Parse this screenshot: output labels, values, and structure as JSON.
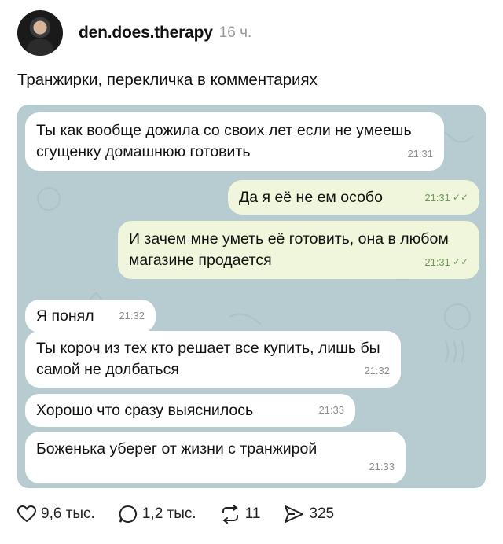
{
  "post": {
    "username": "den.does.therapy",
    "time": "16 ч.",
    "caption": "Транжирки, перекличка в комментариях"
  },
  "chat": {
    "messages": [
      {
        "side": "in",
        "text": "Ты как вообще дожила со своих лет если не умеешь сгущенку домашнюю готовить",
        "time": "21:31"
      },
      {
        "side": "out",
        "text": "Да я её не ем особо",
        "time": "21:31"
      },
      {
        "side": "out",
        "text": "И зачем мне уметь её готовить, она в любом магазине продается",
        "time": "21:31"
      },
      {
        "side": "in",
        "text": "Я понял",
        "time": "21:32"
      },
      {
        "side": "in",
        "text": "Ты короч из тех кто решает все купить, лишь бы самой не долбаться",
        "time": "21:32"
      },
      {
        "side": "in",
        "text": "Хорошо что сразу выяснилось",
        "time": "21:33"
      },
      {
        "side": "in",
        "text": "Боженька уберег от жизни с транжирой",
        "time": "21:33"
      }
    ],
    "read_mark": "✓✓"
  },
  "actions": {
    "likes": "9,6 тыс.",
    "comments": "1,2 тыс.",
    "reposts": "11",
    "shares": "325"
  },
  "icons": {
    "like": "heart-icon",
    "comment": "comment-icon",
    "repost": "repost-icon",
    "share": "send-icon"
  }
}
